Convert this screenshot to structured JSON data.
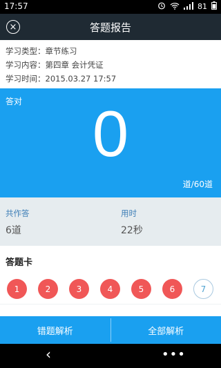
{
  "status": {
    "time": "17:57",
    "battery": "81",
    "icons": [
      "alarm-icon",
      "wifi-icon",
      "signal-icon",
      "battery-icon"
    ]
  },
  "header": {
    "title": "答题报告",
    "close_icon": "×"
  },
  "info": {
    "type": "学习类型：章节练习",
    "content": "学习内容：第四章 会计凭证",
    "time": "学习时间：2015.03.27 17:57"
  },
  "score": {
    "label": "答对",
    "value": "0",
    "total": "道/60道"
  },
  "stats": {
    "total_label": "共作答",
    "total_value": "6道",
    "time_label": "用时",
    "time_value": "22秒"
  },
  "answer_card": {
    "title": "答题卡",
    "items": [
      "1",
      "2",
      "3",
      "4",
      "5",
      "6",
      "7"
    ]
  },
  "actions": {
    "wrong_analysis": "错题解析",
    "all_analysis": "全部解析"
  },
  "nav": {
    "back_symbol": "‹",
    "more_symbol": "•••"
  },
  "colors": {
    "primary": "#1aa0f0",
    "header": "#1f2a33",
    "wrong": "#f05757",
    "stats_bg": "#e6ecef"
  }
}
